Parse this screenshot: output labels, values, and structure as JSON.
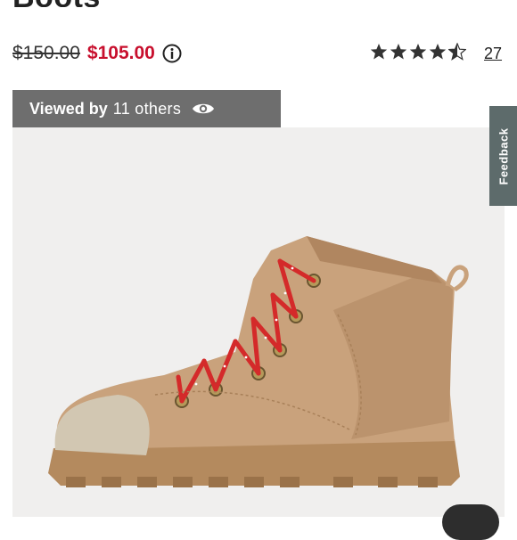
{
  "product": {
    "title": "Boots",
    "old_price": "$150.00",
    "new_price": "$105.00",
    "rating": 4.5,
    "review_count": "27"
  },
  "viewed": {
    "lead": "Viewed by",
    "count": "11 others"
  },
  "feedback": {
    "label": "Feedback"
  },
  "colors": {
    "sale_red": "#c8102e",
    "banner_gray": "#6e6e6e",
    "feedback_bg": "#5d6b6b",
    "boot_tan": "#c9a27c",
    "lace_red": "#d42a2a"
  },
  "icons": [
    "info-icon",
    "star-icon",
    "eye-icon"
  ]
}
